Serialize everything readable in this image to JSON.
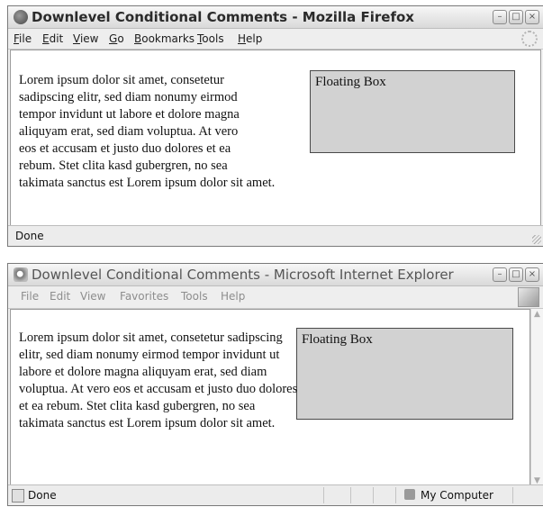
{
  "firefox": {
    "title": "Downlevel Conditional Comments - Mozilla Firefox",
    "menu": [
      "File",
      "Edit",
      "View",
      "Go",
      "Bookmarks",
      "Tools",
      "Help"
    ],
    "float_box": "Floating Box",
    "paragraph": "Lorem ipsum dolor sit amet, consetetur sadipscing elitr, sed diam nonumy eirmod tempor invidunt ut labore et dolore magna aliquyam erat, sed diam voluptua. At vero eos et accusam et justo duo dolores et ea rebum. Stet clita kasd gubergren, no sea takimata sanctus est Lorem ipsum dolor sit amet.",
    "status": "Done"
  },
  "ie": {
    "title": "Downlevel Conditional Comments - Microsoft Internet Explorer",
    "menu": [
      "File",
      "Edit",
      "View",
      "Favorites",
      "Tools",
      "Help"
    ],
    "float_box": "Floating Box",
    "paragraph": "Lorem ipsum dolor sit amet, consetetur sadipscing elitr, sed diam nonumy eirmod tempor invidunt ut labore et dolore magna aliquyam erat, sed diam voluptua. At vero eos et accusam et justo duo dolores et ea rebum. Stet clita kasd gubergren, no sea takimata sanctus est Lorem ipsum dolor sit amet.",
    "status": "Done",
    "zone": "My Computer"
  },
  "colors": {
    "float_bg": "#d2d2d2",
    "content_bg": "#ffffff",
    "chrome": "#eeeeee"
  },
  "icons": [
    "firefox-icon",
    "ie-icon",
    "minimize-icon",
    "maximize-icon",
    "close-icon",
    "throbber-icon",
    "ie-logo-icon",
    "page-icon",
    "computer-icon"
  ]
}
